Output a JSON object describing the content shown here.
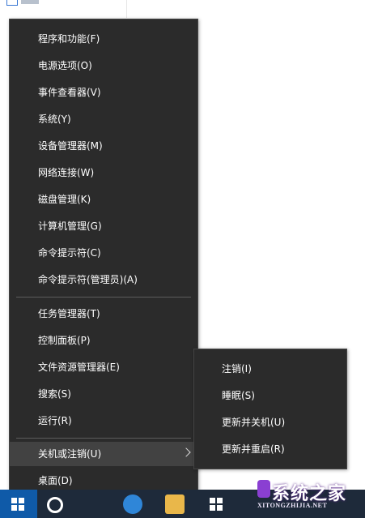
{
  "main_menu": {
    "items": [
      {
        "label": "程序和功能(F)"
      },
      {
        "label": "电源选项(O)"
      },
      {
        "label": "事件查看器(V)"
      },
      {
        "label": "系统(Y)"
      },
      {
        "label": "设备管理器(M)"
      },
      {
        "label": "网络连接(W)"
      },
      {
        "label": "磁盘管理(K)"
      },
      {
        "label": "计算机管理(G)"
      },
      {
        "label": "命令提示符(C)"
      },
      {
        "label": "命令提示符(管理员)(A)"
      },
      {
        "label": "任务管理器(T)"
      },
      {
        "label": "控制面板(P)"
      },
      {
        "label": "文件资源管理器(E)"
      },
      {
        "label": "搜索(S)"
      },
      {
        "label": "运行(R)"
      },
      {
        "label": "关机或注销(U)"
      },
      {
        "label": "桌面(D)"
      }
    ]
  },
  "submenu": {
    "items": [
      {
        "label": "注销(I)"
      },
      {
        "label": "睡眠(S)"
      },
      {
        "label": "更新并关机(U)"
      },
      {
        "label": "更新并重启(R)"
      }
    ]
  },
  "watermark": {
    "main": "系统之家",
    "sub": "XITONGZHIJIA.NET"
  },
  "colors": {
    "menu_bg": "#2b2b2b",
    "menu_highlight": "#424242",
    "taskbar": "#1e2a3a",
    "start_button": "#0f5aa8"
  },
  "icons": {
    "start": "windows-logo-icon",
    "search": "search-icon",
    "edge": "edge-browser-icon",
    "explorer": "file-explorer-icon",
    "store": "store-icon",
    "submenu_arrow": "chevron-right-icon"
  }
}
